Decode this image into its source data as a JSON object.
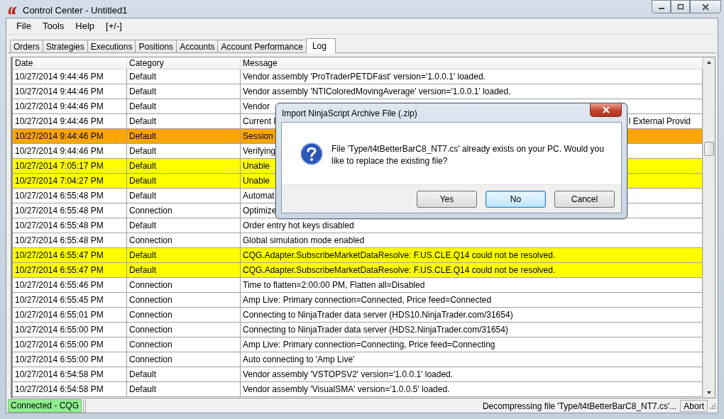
{
  "window": {
    "title": "Control Center - Untitled1"
  },
  "menu": [
    "File",
    "Tools",
    "Help",
    "[+/-]"
  ],
  "tabs": [
    {
      "label": "Orders",
      "selected": false
    },
    {
      "label": "Strategies",
      "selected": false
    },
    {
      "label": "Executions",
      "selected": false
    },
    {
      "label": "Positions",
      "selected": false
    },
    {
      "label": "Accounts",
      "selected": false
    },
    {
      "label": "Account Performance",
      "selected": false
    },
    {
      "label": "Log",
      "selected": true
    }
  ],
  "log": {
    "columns": [
      "Date",
      "Category",
      "Message"
    ],
    "rows": [
      {
        "date": "10/27/2014 9:44:46 PM",
        "category": "Default",
        "message": "Vendor assembly 'ProTraderPETDFast' version='1.0.0.1' loaded.",
        "color": "#ffffff"
      },
      {
        "date": "10/27/2014 9:44:46 PM",
        "category": "Default",
        "message": "Vendor assembly 'NTIColoredMovingAverage' version='1.0.0.1' loaded.",
        "color": "#ffffff"
      },
      {
        "date": "10/27/2014 9:44:46 PM",
        "category": "Default",
        "message": "Vendor",
        "color": "#ffffff"
      },
      {
        "date": "10/27/2014 9:44:46 PM",
        "category": "Default",
        "message": "Current I",
        "message_tail": "l External Provid",
        "color": "#ffffff"
      },
      {
        "date": "10/27/2014 9:44:46 PM",
        "category": "Default",
        "message": "Session",
        "color": "#ffa500"
      },
      {
        "date": "10/27/2014 9:44:46 PM",
        "category": "Default",
        "message": "Verifying",
        "color": "#ffffff"
      },
      {
        "date": "10/27/2014 7:05:17 PM",
        "category": "Default",
        "message": "Unable",
        "color": "#ffff00"
      },
      {
        "date": "10/27/2014 7:04:27 PM",
        "category": "Default",
        "message": "Unable",
        "color": "#ffff00"
      },
      {
        "date": "10/27/2014 6:55:48 PM",
        "category": "Default",
        "message": "Automat",
        "color": "#ffffff"
      },
      {
        "date": "10/27/2014 6:55:48 PM",
        "category": "Connection",
        "message": "Optimize",
        "color": "#ffffff"
      },
      {
        "date": "10/27/2014 6:55:48 PM",
        "category": "Default",
        "message": "Order entry hot keys disabled",
        "color": "#ffffff"
      },
      {
        "date": "10/27/2014 6:55:48 PM",
        "category": "Connection",
        "message": "Global simulation mode enabled",
        "color": "#ffffff"
      },
      {
        "date": "10/27/2014 6:55:47 PM",
        "category": "Default",
        "message": "CQG.Adapter.SubscribeMarketDataResolve: F.US.CLE.Q14 could not be resolved.",
        "color": "#ffff00"
      },
      {
        "date": "10/27/2014 6:55:47 PM",
        "category": "Default",
        "message": "CQG.Adapter.SubscribeMarketDataResolve: F.US.CLE.Q14 could not be resolved.",
        "color": "#ffff00"
      },
      {
        "date": "10/27/2014 6:55:46 PM",
        "category": "Connection",
        "message": "Time to flatten=2:00:00 PM, Flatten all=Disabled",
        "color": "#ffffff"
      },
      {
        "date": "10/27/2014 6:55:45 PM",
        "category": "Connection",
        "message": "Amp Live: Primary connection=Connected, Price feed=Connected",
        "color": "#ffffff"
      },
      {
        "date": "10/27/2014 6:55:01 PM",
        "category": "Connection",
        "message": "Connecting to NinjaTrader data server (HDS10.NinjaTrader.com/31654)",
        "color": "#ffffff"
      },
      {
        "date": "10/27/2014 6:55:00 PM",
        "category": "Connection",
        "message": "Connecting to NinjaTrader data server (HDS2.NinjaTrader.com/31654)",
        "color": "#ffffff"
      },
      {
        "date": "10/27/2014 6:55:00 PM",
        "category": "Connection",
        "message": "Amp Live: Primary connection=Connecting, Price feed=Connecting",
        "color": "#ffffff"
      },
      {
        "date": "10/27/2014 6:55:00 PM",
        "category": "Connection",
        "message": "Auto connecting to 'Amp Live'",
        "color": "#ffffff"
      },
      {
        "date": "10/27/2014 6:54:58 PM",
        "category": "Default",
        "message": "Vendor assembly 'VSTOPSV2' version='1.0.0.1' loaded.",
        "color": "#ffffff"
      },
      {
        "date": "10/27/2014 6:54:58 PM",
        "category": "Default",
        "message": "Vendor assembly 'VisualSMA' version='1.0.0.5' loaded.",
        "color": "#ffffff"
      }
    ]
  },
  "dialog": {
    "title": "Import NinjaScript Archive File (.zip)",
    "message": "File 'Type/t4tBetterBarC8_NT7.cs' already exists on your PC. Would you like to replace the existing file?",
    "buttons": [
      {
        "label": "Yes",
        "focused": false
      },
      {
        "label": "No",
        "focused": true
      },
      {
        "label": "Cancel",
        "focused": false
      }
    ]
  },
  "status_bar": {
    "connection": "Connected - CQG",
    "message": "Decompressing file 'Type/t4tBetterBarC8_NT7.cs'...",
    "abort": "Abort"
  }
}
